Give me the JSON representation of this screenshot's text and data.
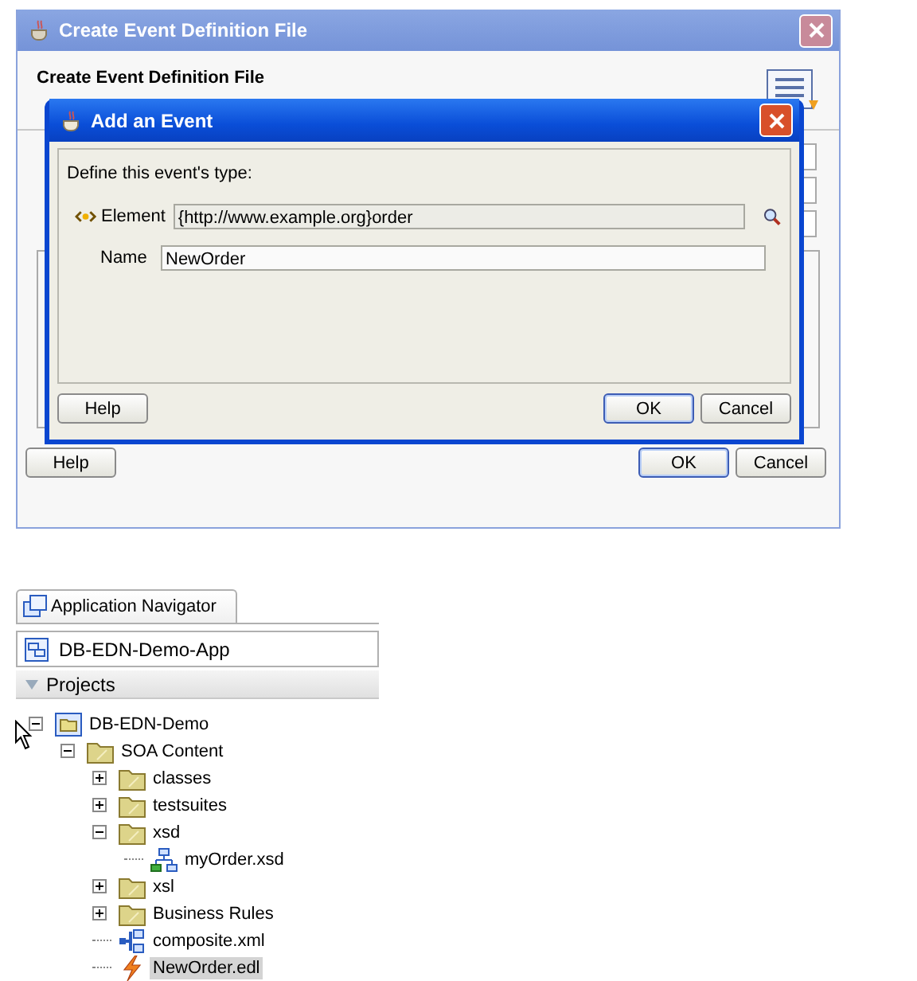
{
  "outer_dialog": {
    "title": "Create Event Definition File",
    "heading": "Create Event Definition File",
    "buttons": [
      {
        "label": "Help",
        "kind": "help",
        "default": false
      },
      {
        "label": "OK",
        "kind": "ok",
        "default": true
      },
      {
        "label": "Cancel",
        "kind": "cancel",
        "default": false
      }
    ]
  },
  "event_dialog": {
    "title": "Add an Event",
    "prompt": "Define this event's type:",
    "element": {
      "label": "Element",
      "value": "{http://www.example.org}order"
    },
    "name": {
      "label": "Name",
      "value": "NewOrder"
    },
    "buttons": [
      {
        "label": "Help",
        "kind": "help",
        "default": false
      },
      {
        "label": "OK",
        "kind": "ok",
        "default": true
      },
      {
        "label": "Cancel",
        "kind": "cancel",
        "default": false
      }
    ]
  },
  "navigator": {
    "tab": "Application Navigator",
    "application": "DB-EDN-Demo-App",
    "section": {
      "label": "Projects",
      "expanded": true
    },
    "tree": [
      {
        "label": "DB-EDN-Demo",
        "kind": "project",
        "expanded": true,
        "selected": false,
        "children": [
          {
            "label": "SOA Content",
            "kind": "folder",
            "expanded": true,
            "selected": false,
            "children": [
              {
                "label": "classes",
                "kind": "folder",
                "expanded": false,
                "selected": false
              },
              {
                "label": "testsuites",
                "kind": "folder",
                "expanded": false,
                "selected": false
              },
              {
                "label": "xsd",
                "kind": "folder",
                "expanded": true,
                "selected": false,
                "children": [
                  {
                    "label": "myOrder.xsd",
                    "kind": "schema",
                    "selected": false
                  }
                ]
              },
              {
                "label": "xsl",
                "kind": "folder",
                "expanded": false,
                "selected": false
              },
              {
                "label": "Business Rules",
                "kind": "folder",
                "expanded": false,
                "selected": false
              },
              {
                "label": "composite.xml",
                "kind": "composite",
                "selected": false
              },
              {
                "label": "NewOrder.edl",
                "kind": "event",
                "selected": true
              }
            ]
          }
        ]
      }
    ]
  }
}
